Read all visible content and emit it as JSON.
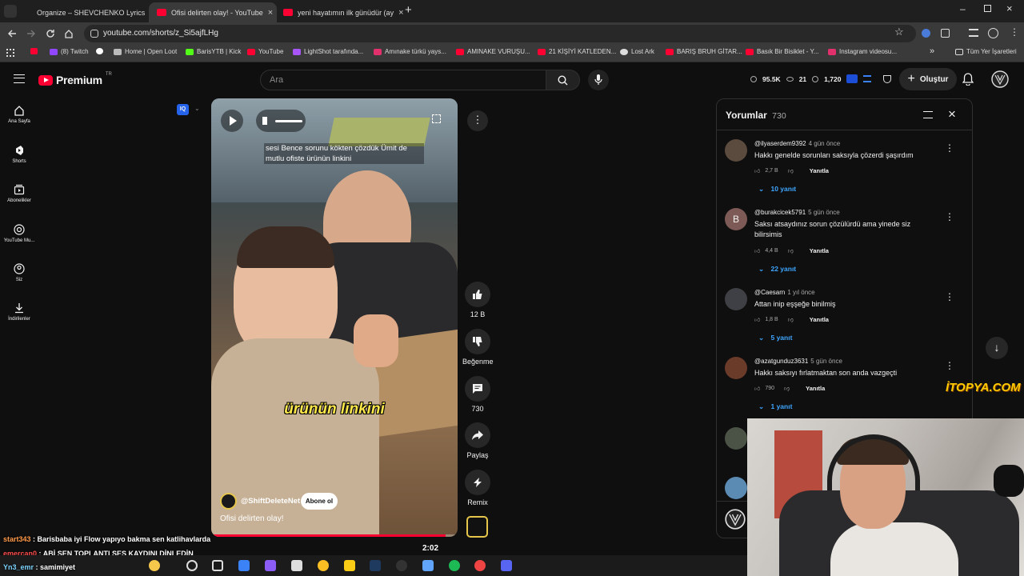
{
  "browser": {
    "tabs": [
      {
        "title": "Organize – SHEVCHENKO Lyrics",
        "active": false
      },
      {
        "title": "Ofisi delirten olay! - YouTube",
        "active": true
      },
      {
        "title": "yeni hayatımın ilk günüdür (ay",
        "active": false
      }
    ],
    "url": "youtube.com/shorts/z_Si5ajfLHg",
    "bookmarks": [
      "(8) Twitch",
      "Home | Open Loot",
      "BarisYTB | Kick",
      "YouTube",
      "LightShot tarafında...",
      "Amınake türkü yays...",
      "AMINAKE VURUŞU...",
      "21 KİŞİYİ KATLEDEN...",
      "Lost Ark",
      "BARIŞ BRUH GİTAR...",
      "Basık Bir Bisiklet - Y...",
      "Instagram videosu..."
    ],
    "bookmarks_all": "Tüm Yer İşaretleri"
  },
  "youtube": {
    "logo": "Premium",
    "region": "TR",
    "search_placeholder": "Ara",
    "stats": {
      "views": "95.5K",
      "eye": "21",
      "viewers": "1,720"
    },
    "create_label": "Oluştur",
    "sidebar": [
      {
        "label": "Ana Sayfa",
        "icon": "home-icon"
      },
      {
        "label": "Shorts",
        "icon": "shorts-icon"
      },
      {
        "label": "Abonelikler",
        "icon": "subscriptions-icon"
      },
      {
        "label": "YouTube Mu...",
        "icon": "music-icon"
      },
      {
        "label": "Siz",
        "icon": "user-icon"
      },
      {
        "label": "İndirilenler",
        "icon": "download-icon"
      }
    ]
  },
  "short": {
    "caption_top": "sesi Bence sorunu kökten çözdük Ümit de mutlu ofiste ürünün linkini",
    "caption_big": "ürünün linkini",
    "channel": "@ShiftDeleteNet",
    "subscribe_label": "Abone ol",
    "title": "Ofisi delirten olay!",
    "progress": 0.95,
    "actions": {
      "likes": "12 B",
      "dislike": "Beğenme",
      "comments": "730",
      "share": "Paylaş",
      "remix": "Remix"
    }
  },
  "comments_panel": {
    "title": "Yorumlar",
    "count": "730",
    "items": [
      {
        "user": "@ilyaserdem9392",
        "time": "4 gün önce",
        "text": "Hakkı genelde sorunları saksıyla çözerdi şaşırdım",
        "likes": "2,7 B",
        "reply": "Yanıtla",
        "replies": "10 yanıt",
        "avatar_color": "#5b4a3e"
      },
      {
        "user": "@burakcicek5791",
        "time": "5 gün önce",
        "text": "Saksı atsaydınız sorun çözülürdü ama yinede siz bilirsimis",
        "likes": "4,4 B",
        "reply": "Yanıtla",
        "replies": "22 yanıt",
        "avatar_color": "#7d5a55",
        "avatar_letter": "B"
      },
      {
        "user": "@Caesarn",
        "time": "1 yıl önce",
        "text": "Attan inip eşşeğe binilmiş",
        "likes": "1,8 B",
        "reply": "Yanıtla",
        "replies": "5 yanıt",
        "avatar_color": "#3f3f46"
      },
      {
        "user": "@azatgunduz3631",
        "time": "5 gün önce",
        "text": "Hakkı saksıyı fırlatmaktan son anda vazgeçti",
        "likes": "790",
        "reply": "Yanıtla",
        "replies": "1 yanıt",
        "avatar_color": "#6b3b2a"
      }
    ]
  },
  "overlay": {
    "watermark": "İTOPYA.COM",
    "chat": [
      {
        "user": "start343",
        "msg": "Barisbaba iyi Flow yapıyo bakma sen katlihavlarda"
      },
      {
        "user": "emercan0",
        "msg": "ABİ SEN TOPLANTI SES KAYDINI DİNLEDİN"
      },
      {
        "user": "Yn3_emr",
        "msg": "samimiyet"
      }
    ],
    "clip_time": "2:02"
  }
}
